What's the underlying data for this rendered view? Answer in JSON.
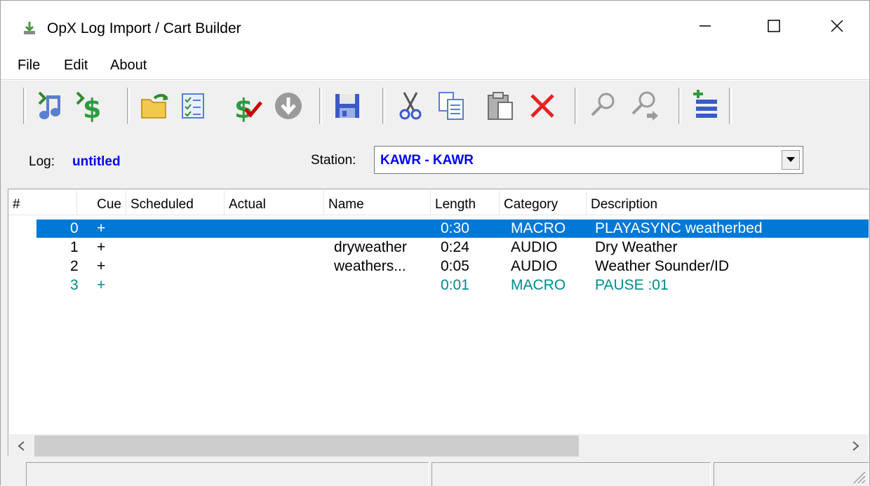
{
  "window": {
    "title": "OpX Log Import / Cart Builder"
  },
  "menu": [
    "File",
    "Edit",
    "About"
  ],
  "info": {
    "log_label": "Log:",
    "log_value": "untitled",
    "station_label": "Station:",
    "station_value": "KAWR - KAWR"
  },
  "list": {
    "columns": [
      "#",
      "Cue",
      "Scheduled",
      "Actual",
      "Name",
      "Length",
      "Category",
      "Description"
    ],
    "rows": [
      {
        "num": "0",
        "cue": "+",
        "scheduled": "",
        "actual": "",
        "name": "",
        "length": "0:30",
        "category": "MACRO",
        "description": "PLAYASYNC weatherbed"
      },
      {
        "num": "1",
        "cue": "+",
        "scheduled": "",
        "actual": "",
        "name": "dryweather",
        "length": "0:24",
        "category": "AUDIO",
        "description": "Dry Weather"
      },
      {
        "num": "2",
        "cue": "+",
        "scheduled": "",
        "actual": "",
        "name": "weathers...",
        "length": "0:05",
        "category": "AUDIO",
        "description": "Weather Sounder/ID"
      },
      {
        "num": "3",
        "cue": "+",
        "scheduled": "",
        "actual": "",
        "name": "",
        "length": "0:01",
        "category": "MACRO",
        "description": "PAUSE :01"
      }
    ]
  },
  "colors": {
    "selection": "#0078d7",
    "macro_text": "#008b8b",
    "log_text": "#0000ff"
  },
  "toolbar_icons": [
    "import-audio-icon",
    "import-money-icon",
    "open-folder-icon",
    "checklist-icon",
    "verify-icon",
    "download-icon",
    "save-icon",
    "cut-icon",
    "copy-icon",
    "paste-icon",
    "delete-icon",
    "find-icon",
    "find-next-icon",
    "cart-builder-icon"
  ]
}
